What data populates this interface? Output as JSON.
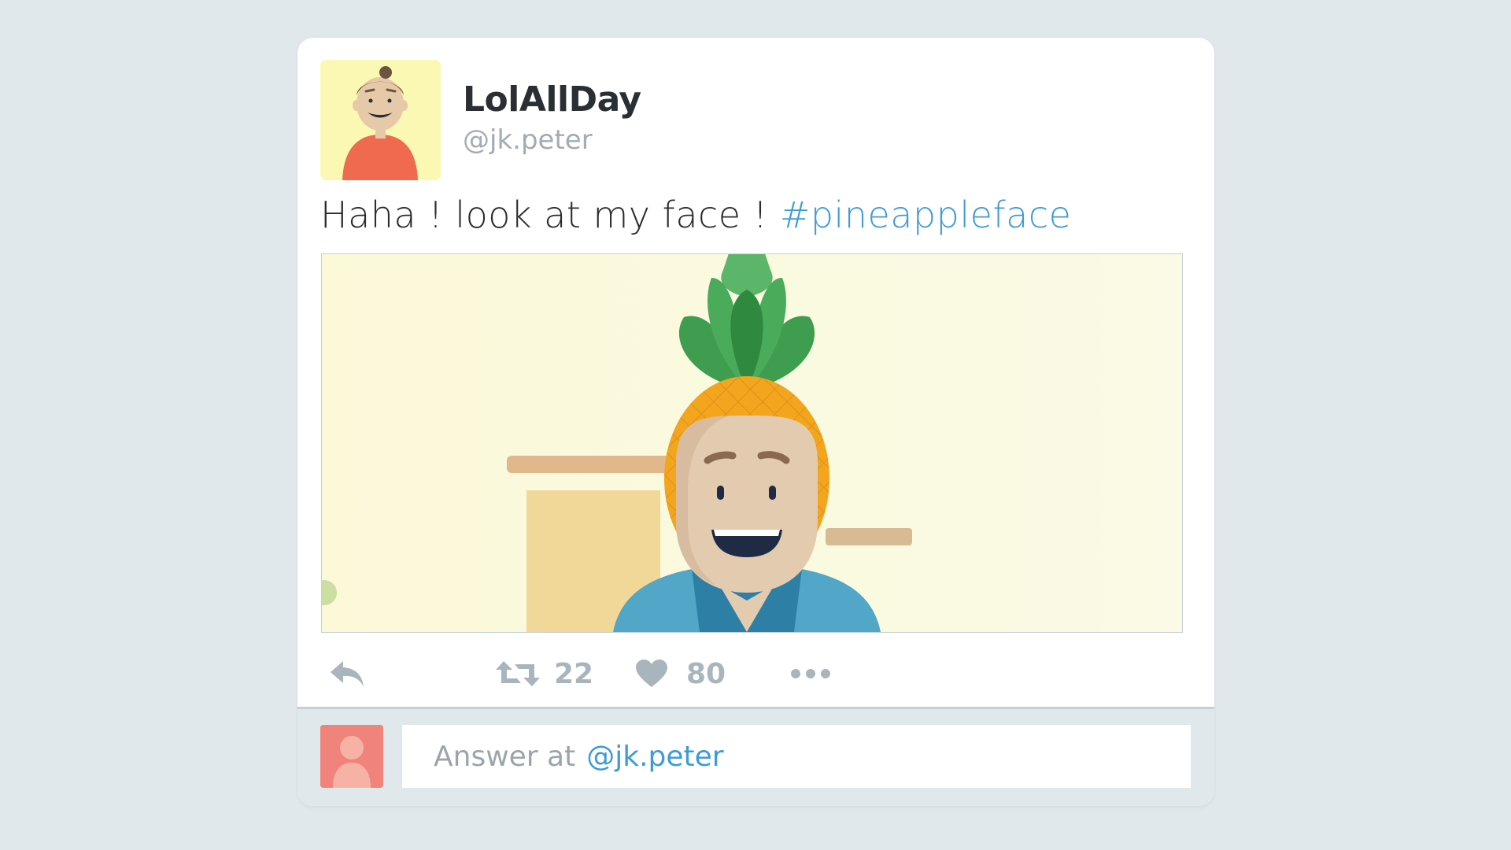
{
  "tweet": {
    "display_name": "LolAllDay",
    "handle": "@jk.peter",
    "text": "Haha ! look at my face ! ",
    "hashtag": "#pineappleface"
  },
  "actions": {
    "reply_icon": "reply-icon",
    "retweet_icon": "retweet-icon",
    "retweet_count": "22",
    "like_icon": "heart-icon",
    "like_count": "80",
    "more_icon": "more-dots-icon"
  },
  "reply_box": {
    "placeholder_prefix": "Answer at",
    "mention": "@jk.peter"
  },
  "colors": {
    "background": "#e1e8eb",
    "link": "#3e9bd6",
    "icon": "#a9b5bc",
    "avatar_bg": "#fbf8b4",
    "reply_avatar_bg": "#f0837b"
  }
}
